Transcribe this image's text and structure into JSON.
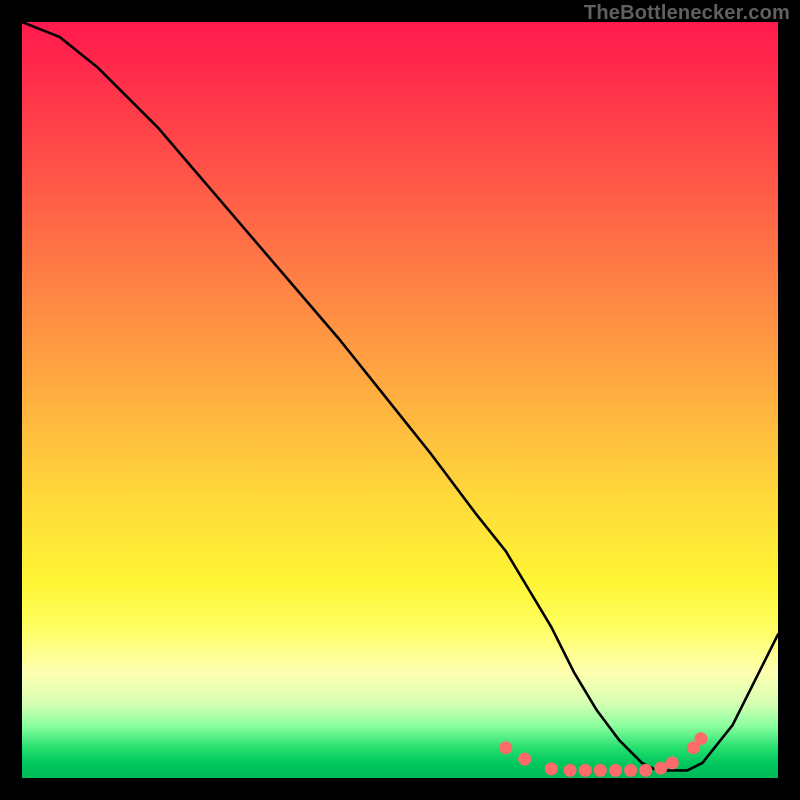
{
  "attribution": "TheBottlenecker.com",
  "chart_data": {
    "type": "line",
    "title": "",
    "xlabel": "",
    "ylabel": "",
    "xlim": [
      0,
      100
    ],
    "ylim": [
      0,
      100
    ],
    "series": [
      {
        "name": "curve",
        "x": [
          0,
          5,
          10,
          18,
          30,
          42,
          54,
          60,
          64,
          67,
          70,
          73,
          76,
          79,
          82,
          84,
          86,
          88,
          90,
          94,
          100
        ],
        "y": [
          100,
          98,
          94,
          86,
          72,
          58,
          43,
          35,
          30,
          25,
          20,
          14,
          9,
          5,
          2,
          1,
          1,
          1,
          2,
          7,
          19
        ]
      }
    ],
    "markers": {
      "name": "dots",
      "color": "#ff6b6b",
      "x": [
        64.0,
        66.5,
        70.0,
        72.5,
        74.5,
        76.5,
        78.5,
        80.5,
        82.5,
        84.5,
        86.0,
        88.8,
        89.8
      ],
      "y": [
        4.0,
        2.5,
        1.2,
        1.0,
        1.0,
        1.0,
        1.0,
        1.0,
        1.0,
        1.3,
        2.0,
        4.0,
        5.2
      ]
    }
  }
}
